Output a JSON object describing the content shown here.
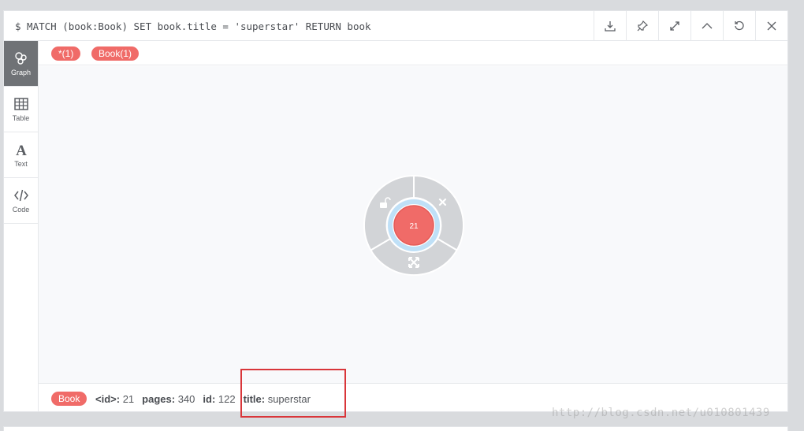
{
  "header": {
    "query": "$ MATCH (book:Book) SET book.title = 'superstar' RETURN book",
    "buttons": [
      "download-icon",
      "pin-icon",
      "expand-icon",
      "collapse-up-icon",
      "refresh-icon",
      "close-icon"
    ]
  },
  "sidebar": {
    "items": [
      {
        "label": "Graph",
        "icon": "graph-icon",
        "active": true
      },
      {
        "label": "Table",
        "icon": "table-icon",
        "active": false
      },
      {
        "label": "Text",
        "icon": "text-icon",
        "active": false
      },
      {
        "label": "Code",
        "icon": "code-icon",
        "active": false
      }
    ]
  },
  "labels_bar": {
    "all_nodes": "*(1)",
    "book_label": "Book(1)"
  },
  "node": {
    "id_text": "21",
    "color": "#f06b68"
  },
  "footer": {
    "label": "Book",
    "props": [
      {
        "key": "<id>:",
        "value": "21"
      },
      {
        "key": "pages:",
        "value": "340"
      },
      {
        "key": "id:",
        "value": "122"
      },
      {
        "key": "title:",
        "value": "superstar"
      }
    ]
  },
  "watermark": "http://blog.csdn.net/u010801439",
  "colors": {
    "accent": "#f06b68",
    "highlight_box": "#d9363a",
    "sidebar_active": "#6f7276"
  }
}
